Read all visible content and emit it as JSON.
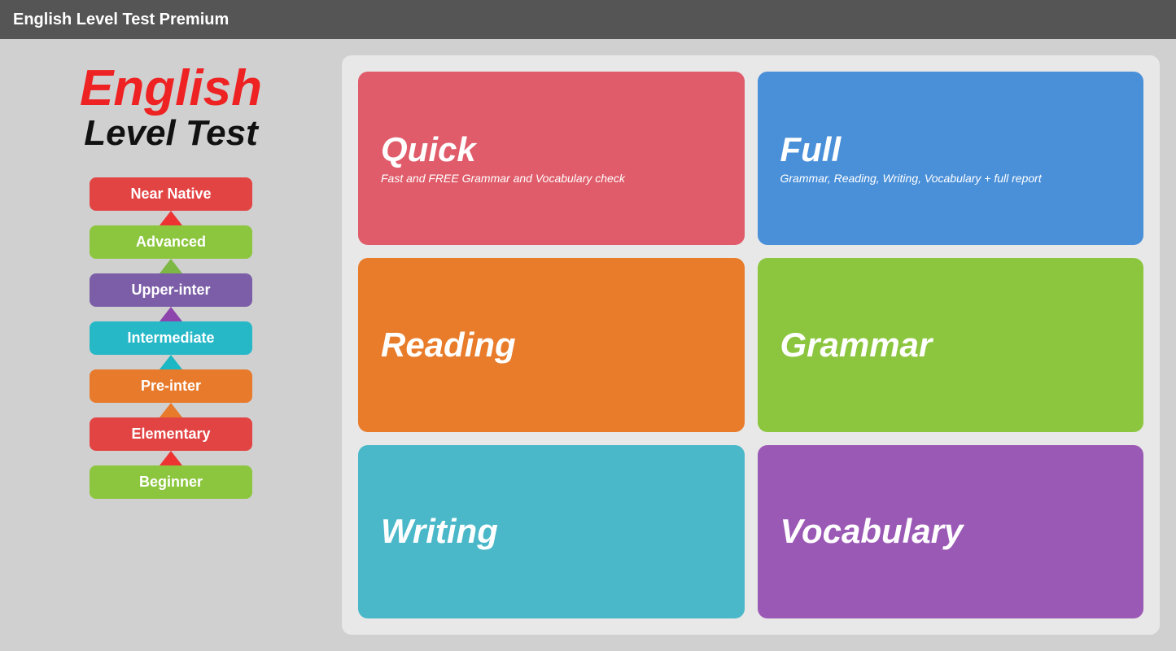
{
  "titlebar": {
    "label": "English Level Test Premium"
  },
  "logo": {
    "english": "English",
    "level_test": "Level Test"
  },
  "levels": [
    {
      "id": "near-native",
      "label": "Near Native",
      "color_class": "btn-near-native",
      "arrow_class": "arrow-up-red"
    },
    {
      "id": "advanced",
      "label": "Advanced",
      "color_class": "btn-advanced",
      "arrow_class": "arrow-up-green"
    },
    {
      "id": "upper-inter",
      "label": "Upper-inter",
      "color_class": "btn-upper-inter",
      "arrow_class": "arrow-up-purple"
    },
    {
      "id": "intermediate",
      "label": "Intermediate",
      "color_class": "btn-intermediate",
      "arrow_class": "arrow-up-cyan"
    },
    {
      "id": "pre-inter",
      "label": "Pre-inter",
      "color_class": "btn-pre-inter",
      "arrow_class": "arrow-up-orange"
    },
    {
      "id": "elementary",
      "label": "Elementary",
      "color_class": "btn-elementary",
      "arrow_class": "arrow-up-red2"
    },
    {
      "id": "beginner",
      "label": "Beginner",
      "color_class": "btn-beginner",
      "arrow_class": null
    }
  ],
  "test_buttons": [
    {
      "id": "quick",
      "title": "Quick",
      "subtitle": "Fast and FREE Grammar and Vocabulary check",
      "color_class": "btn-quick"
    },
    {
      "id": "full",
      "title": "Full",
      "subtitle": "Grammar, Reading, Writing, Vocabulary + full report",
      "color_class": "btn-full"
    },
    {
      "id": "reading",
      "title": "Reading",
      "subtitle": "",
      "color_class": "btn-reading"
    },
    {
      "id": "grammar",
      "title": "Grammar",
      "subtitle": "",
      "color_class": "btn-grammar"
    },
    {
      "id": "writing",
      "title": "Writing",
      "subtitle": "",
      "color_class": "btn-writing"
    },
    {
      "id": "vocabulary",
      "title": "Vocabulary",
      "subtitle": "",
      "color_class": "btn-vocabulary"
    }
  ]
}
